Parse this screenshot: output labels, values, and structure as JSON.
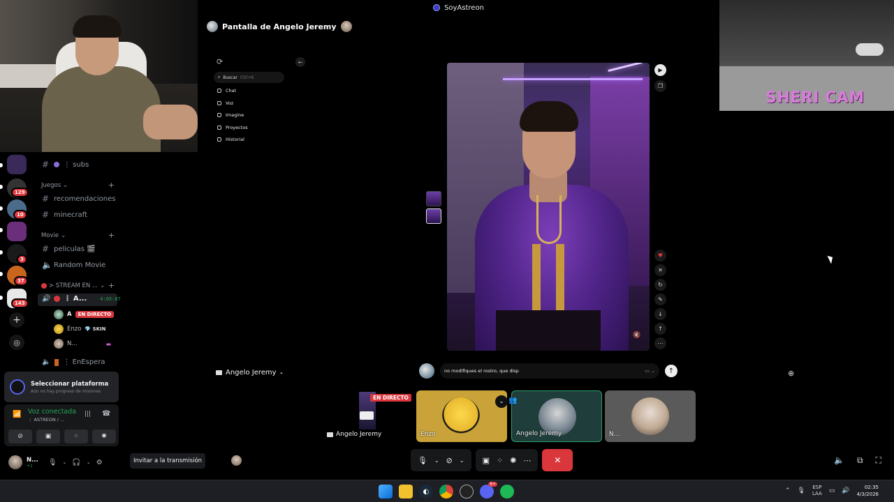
{
  "topbar": {
    "title": "SoyAstreon"
  },
  "stream": {
    "header": "Pantalla de Angelo Jeremy",
    "streamer_name": "Angelo Jeremy"
  },
  "overlay": {
    "cam_label": "SHERI CAM"
  },
  "app": {
    "search_label": "Buscar",
    "search_shortcut": "Ctrl+K",
    "nav": [
      {
        "label": "Chat",
        "icon": "chat-icon"
      },
      {
        "label": "Voz",
        "icon": "voice-icon"
      },
      {
        "label": "Imagine",
        "icon": "image-icon"
      },
      {
        "label": "Proyectos",
        "icon": "folder-icon"
      },
      {
        "label": "Historial",
        "icon": "history-icon"
      }
    ],
    "prompt_text": "no modifiques el rostro, que disp"
  },
  "sidebar": {
    "channels": {
      "subs": "⋮ subs",
      "cat_juegos": "Juegos",
      "recomendaciones": "recomendaciones",
      "minecraft": "minecraft",
      "cat_movie": "Movie",
      "peliculas": "peliculas 🎬",
      "random_movie": "Random Movie",
      "cat_stream": "> STREAM EN ...",
      "active_channel": "⋮ A...",
      "active_timer": "4:05:07",
      "enespera": "⋮ EnEspera"
    },
    "voice_users": [
      {
        "name": "A",
        "tag": "EN DIRECTO"
      },
      {
        "name": "Enzo",
        "tag": "💎 SKIN"
      },
      {
        "name": "N..."
      }
    ],
    "server_badges": [
      "129",
      "10",
      "3",
      "37",
      "143"
    ]
  },
  "platform_card": {
    "title": "Seleccionar plataforma",
    "subtitle": "Aún no hay progreso de misiones"
  },
  "voice_panel": {
    "status": "Voz conectada",
    "channel": "⋮ ASTREON / ..."
  },
  "userbar": {
    "name": "N...",
    "sub": "+1"
  },
  "invite": {
    "label": "Invitar a la transmisión"
  },
  "tiles": [
    {
      "name": "Angelo Jeremy",
      "tag": "EN DIRECTO"
    },
    {
      "name": "Enzo"
    },
    {
      "name": "Angelo Jeremy"
    },
    {
      "name": "N..."
    }
  ],
  "taskbar": {
    "lang_top": "ESP",
    "lang_bottom": "LAA",
    "time": "02:35",
    "date": "4/3/2026",
    "discord_badge": "9+"
  },
  "colors": {
    "live_red": "#da373c",
    "voice_green": "#23a559",
    "accent": "#5865f2"
  }
}
